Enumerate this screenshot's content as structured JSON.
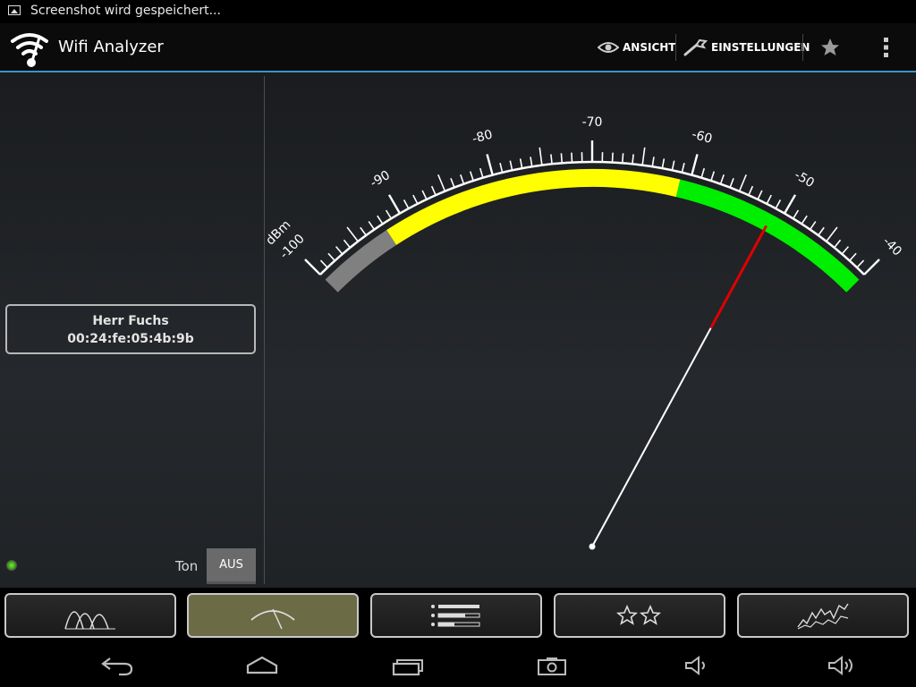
{
  "status_bar": {
    "notification_text": "Screenshot wird gespeichert...",
    "icon": "image-icon"
  },
  "action_bar": {
    "title": "Wifi Analyzer",
    "view_label": "ANSICHT",
    "settings_label": "EINSTELLUNGEN",
    "icons": [
      "wifi-logo-icon",
      "eye-icon",
      "wrench-icon",
      "star-icon",
      "overflow-menu-icon"
    ]
  },
  "access_point": {
    "name": "Herr Fuchs",
    "mac": "00:24:fe:05:4b:9b"
  },
  "sound": {
    "label": "Ton",
    "toggle_value": "AUS"
  },
  "meter": {
    "unit": "dBm",
    "scale_min": -100,
    "scale_max": -40,
    "tick_labels": [
      "-100",
      "-90",
      "-80",
      "-70",
      "-60",
      "-50",
      "-40"
    ],
    "needle_value": -51,
    "zones": [
      {
        "from": -100,
        "to": -92,
        "color": "#808080"
      },
      {
        "from": -92,
        "to": -61,
        "color": "#ffff00"
      },
      {
        "from": -61,
        "to": -40,
        "color": "#00ee00"
      }
    ],
    "tick_color": "#ffffff",
    "needle_color": "#ffffff",
    "needle_tip_color": "#e00000"
  },
  "tabs": [
    {
      "name": "channel-graph",
      "icon": "channel-graph-icon",
      "active": false
    },
    {
      "name": "signal-meter",
      "icon": "signal-meter-icon",
      "active": true
    },
    {
      "name": "ap-list",
      "icon": "ap-list-icon",
      "active": false
    },
    {
      "name": "channel-rating",
      "icon": "stars-icon",
      "active": false
    },
    {
      "name": "time-graph",
      "icon": "time-graph-icon",
      "active": false
    }
  ],
  "nav_bar": {
    "icons": [
      "back-icon",
      "home-icon",
      "recent-apps-icon",
      "screenshot-icon",
      "volume-down-icon",
      "volume-up-icon"
    ]
  },
  "colors": {
    "accent": "#3a94c8",
    "active_tab": "#6b6b46"
  }
}
